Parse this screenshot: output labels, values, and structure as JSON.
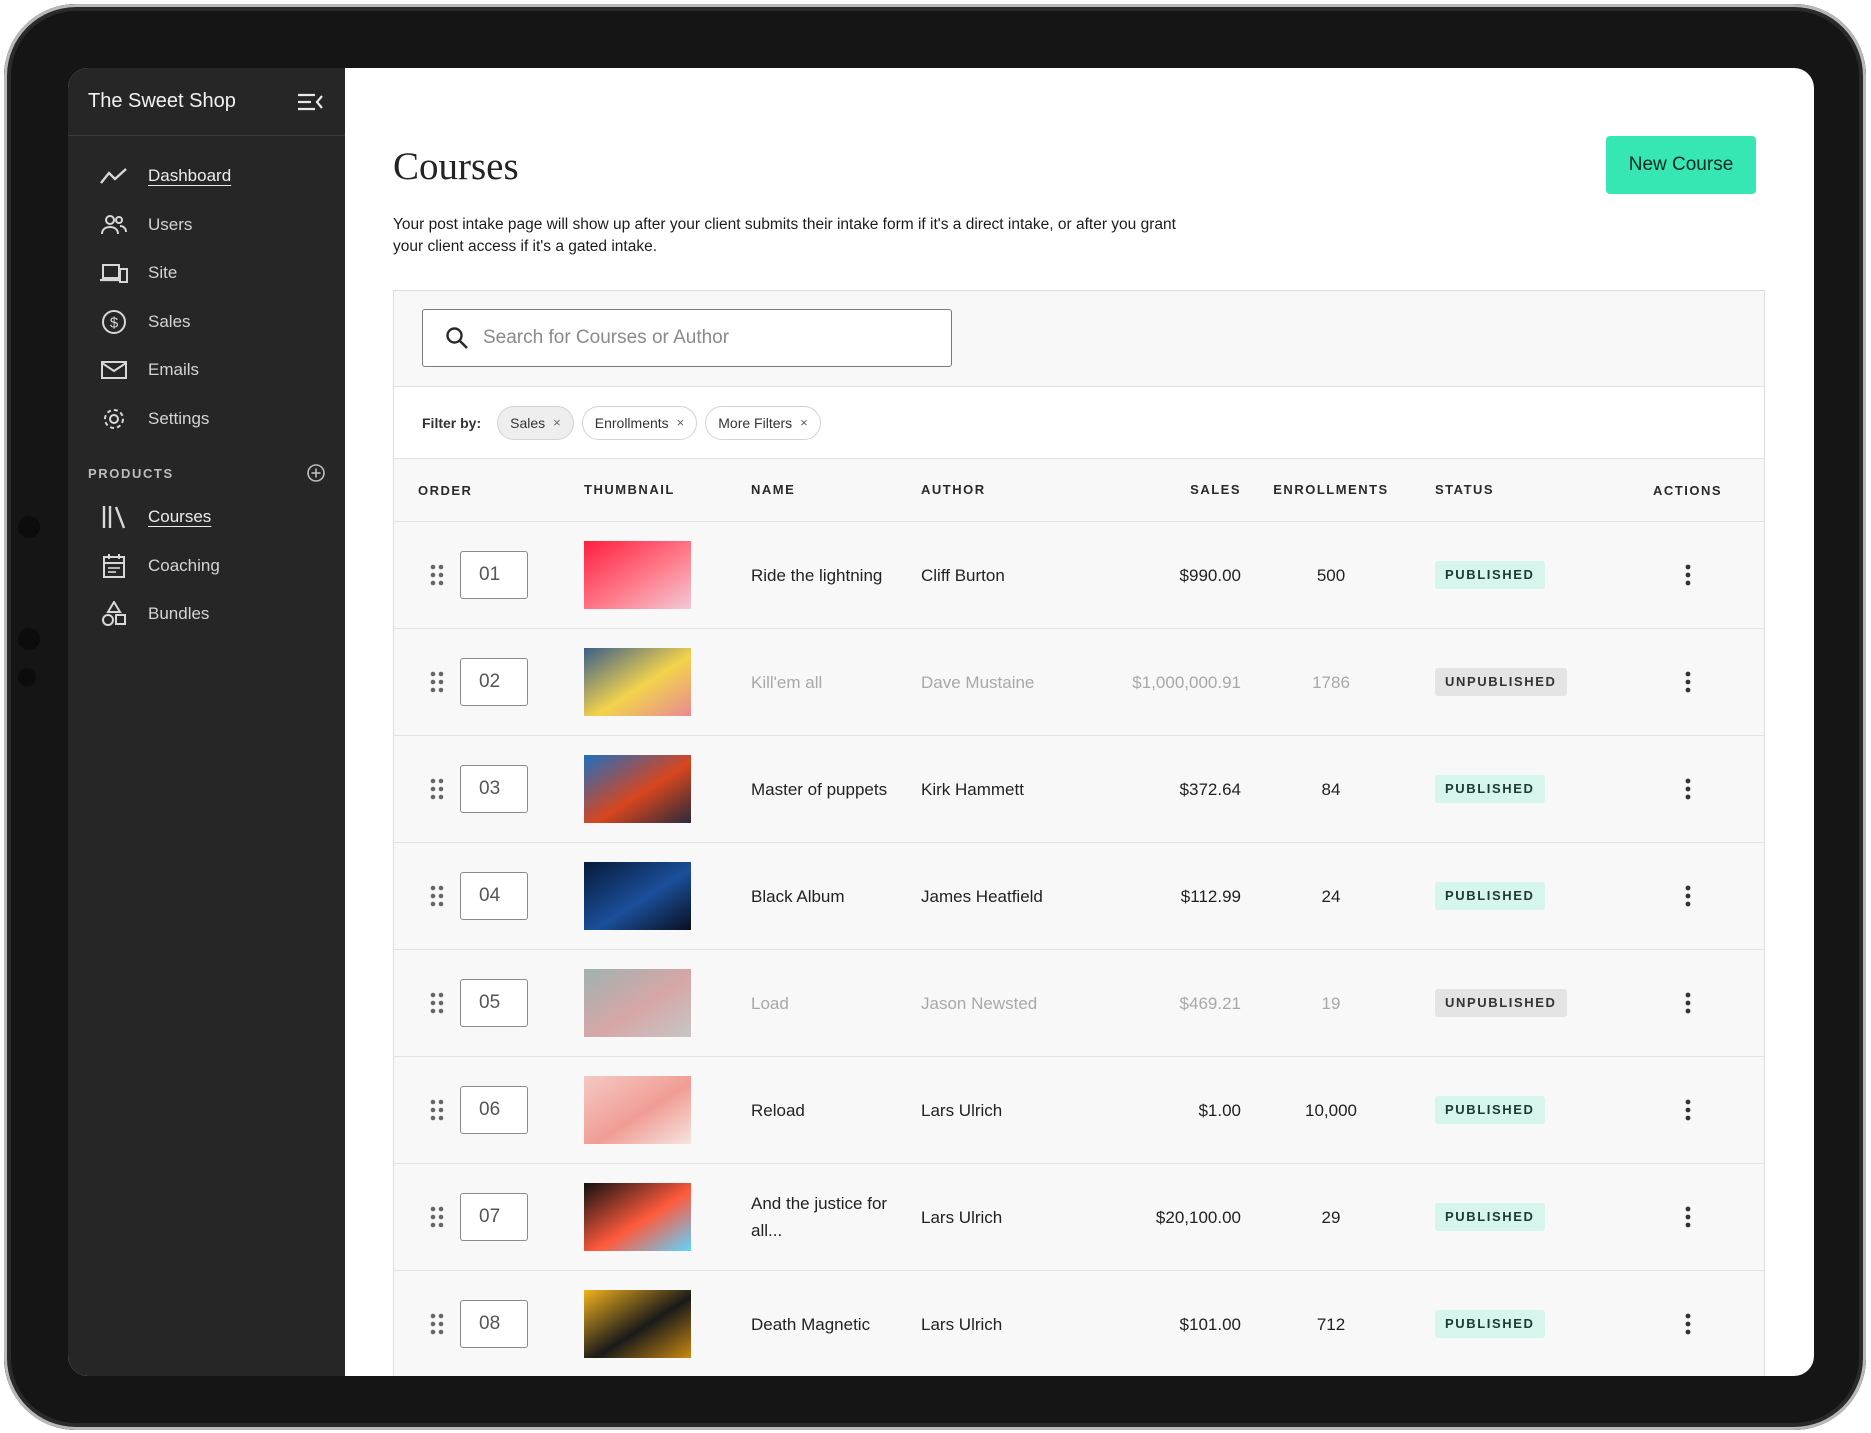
{
  "app": {
    "name": "The Sweet Shop"
  },
  "sidebar": {
    "items": [
      {
        "label": "Dashboard",
        "icon": "chart-line-icon",
        "active": true
      },
      {
        "label": "Users",
        "icon": "users-icon"
      },
      {
        "label": "Site",
        "icon": "devices-icon"
      },
      {
        "label": "Sales",
        "icon": "dollar-circle-icon"
      },
      {
        "label": "Emails",
        "icon": "mail-icon"
      },
      {
        "label": "Settings",
        "icon": "gear-icon"
      }
    ],
    "products_heading": "PRODUCTS",
    "products": [
      {
        "label": "Courses",
        "icon": "library-icon",
        "active": true
      },
      {
        "label": "Coaching",
        "icon": "calendar-icon"
      },
      {
        "label": "Bundles",
        "icon": "shapes-icon"
      }
    ]
  },
  "page": {
    "title": "Courses",
    "new_button": "New Course",
    "intro": "Your post intake page will show up after your client submits their intake form if it's a direct intake, or after you grant your client access if it's a gated intake."
  },
  "search": {
    "placeholder": "Search for Courses or Author"
  },
  "filters": {
    "label": "Filter by:",
    "chips": [
      "Sales",
      "Enrollments",
      "More Filters"
    ],
    "selected": "Sales"
  },
  "table": {
    "headers": {
      "order": "ORDER",
      "thumbnail": "THUMBNAIL",
      "name": "NAME",
      "author": "AUTHOR",
      "sales": "SALES",
      "enrollments": "ENROLLMENTS",
      "status": "STATUS",
      "actions": "ACTIONS"
    },
    "rows": [
      {
        "order": "01",
        "name": "Ride the lightning",
        "author": "Cliff Burton",
        "sales": "$990.00",
        "enrollments": "500",
        "status": "PUBLISHED",
        "colors": [
          "#ff1f3f",
          "#ff7a8a",
          "#f2c9d6"
        ]
      },
      {
        "order": "02",
        "name": "Kill'em all",
        "author": "Dave Mustaine",
        "sales": "$1,000,000.91",
        "enrollments": "1786",
        "status": "UNPUBLISHED",
        "colors": [
          "#3b5f8a",
          "#f3d34b",
          "#e88a93"
        ]
      },
      {
        "order": "03",
        "name": "Master of puppets",
        "author": "Kirk Hammett",
        "sales": "$372.64",
        "enrollments": "84",
        "status": "PUBLISHED",
        "colors": [
          "#1e6fbf",
          "#d8461e",
          "#2a2a3a"
        ]
      },
      {
        "order": "04",
        "name": "Black Album",
        "author": "James Heatfield",
        "sales": "$112.99",
        "enrollments": "24",
        "status": "PUBLISHED",
        "colors": [
          "#061a3a",
          "#1b4f9a",
          "#0a0f20"
        ]
      },
      {
        "order": "05",
        "name": "Load",
        "author": "Jason Newsted",
        "sales": "$469.21",
        "enrollments": "19",
        "status": "UNPUBLISHED",
        "colors": [
          "#9fb3b0",
          "#d7a6a6",
          "#c6c6c6"
        ]
      },
      {
        "order": "06",
        "name": "Reload",
        "author": "Lars Ulrich",
        "sales": "$1.00",
        "enrollments": "10,000",
        "status": "PUBLISHED",
        "colors": [
          "#f5c9c4",
          "#f09d94",
          "#f7e4e1"
        ]
      },
      {
        "order": "07",
        "name": "And the justice for all...",
        "author": "Lars Ulrich",
        "sales": "$20,100.00",
        "enrollments": "29",
        "status": "PUBLISHED",
        "colors": [
          "#111111",
          "#ff5a3c",
          "#5fd4ff"
        ]
      },
      {
        "order": "08",
        "name": "Death Magnetic",
        "author": "Lars Ulrich",
        "sales": "$101.00",
        "enrollments": "712",
        "status": "PUBLISHED",
        "colors": [
          "#f1b21c",
          "#1a1a1a",
          "#c98a10"
        ]
      }
    ]
  },
  "colors": {
    "accent": "#36e6b3",
    "sidebar": "#262626",
    "published_bg": "#d6f5ec",
    "unpublished_bg": "#e4e4e4"
  }
}
